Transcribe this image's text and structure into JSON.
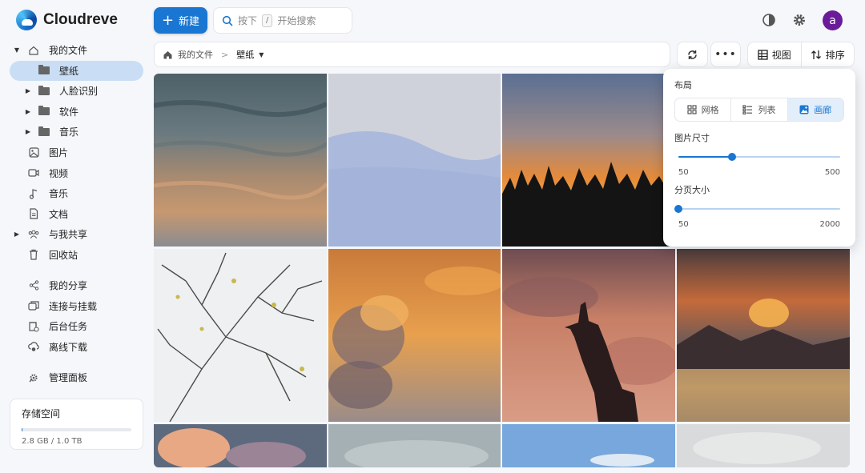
{
  "app": {
    "name": "Cloudreve"
  },
  "sidebar": {
    "items": [
      {
        "label": "我的文件",
        "icon": "home-icon",
        "caret": "▼",
        "active": false
      },
      {
        "label": "壁纸",
        "icon": "folder-icon",
        "caret": "",
        "active": true
      },
      {
        "label": "人脸识别",
        "icon": "folder-icon",
        "caret": "▶",
        "active": false
      },
      {
        "label": "软件",
        "icon": "folder-icon",
        "caret": "▶",
        "active": false
      },
      {
        "label": "音乐",
        "icon": "folder-icon",
        "caret": "▶",
        "active": false
      },
      {
        "label": "图片",
        "icon": "image-icon",
        "caret": "",
        "active": false
      },
      {
        "label": "视频",
        "icon": "video-icon",
        "caret": "",
        "active": false
      },
      {
        "label": "音乐",
        "icon": "music-icon",
        "caret": "",
        "active": false
      },
      {
        "label": "文档",
        "icon": "document-icon",
        "caret": "",
        "active": false
      },
      {
        "label": "与我共享",
        "icon": "people-icon",
        "caret": "▶",
        "active": false
      },
      {
        "label": "回收站",
        "icon": "trash-icon",
        "caret": "",
        "active": false
      },
      {
        "label": "我的分享",
        "icon": "share-icon",
        "caret": "",
        "active": false
      },
      {
        "label": "连接与挂载",
        "icon": "mount-icon",
        "caret": "",
        "active": false
      },
      {
        "label": "后台任务",
        "icon": "tasks-icon",
        "caret": "",
        "active": false
      },
      {
        "label": "离线下载",
        "icon": "download-icon",
        "caret": "",
        "active": false
      },
      {
        "label": "管理面板",
        "icon": "admin-icon",
        "caret": "",
        "active": false
      }
    ],
    "storage": {
      "title": "存储空间",
      "text": "2.8 GB / 1.0 TB",
      "used_fraction": 0.003
    }
  },
  "topbar": {
    "new_label": "新建",
    "search_prefix": "按下",
    "search_key": "/",
    "search_suffix": "开始搜索",
    "avatar_letter": "a"
  },
  "breadcrumb": {
    "root": "我的文件",
    "separator": ">",
    "current": "壁纸"
  },
  "toolbar": {
    "view_label": "视图",
    "sort_label": "排序"
  },
  "popover": {
    "layout_title": "布局",
    "layout_options": [
      "网格",
      "列表",
      "画廊"
    ],
    "selected_layout": "画廊",
    "image_size_title": "图片尺寸",
    "image_size_min": "50",
    "image_size_max": "500",
    "image_size_value": 200,
    "page_size_title": "分页大小",
    "page_size_min": "50",
    "page_size_max": "2000",
    "page_size_value": 50
  },
  "colors": {
    "accent": "#1976d2",
    "avatar": "#6a1b9a",
    "active_item": "#c9def5"
  }
}
